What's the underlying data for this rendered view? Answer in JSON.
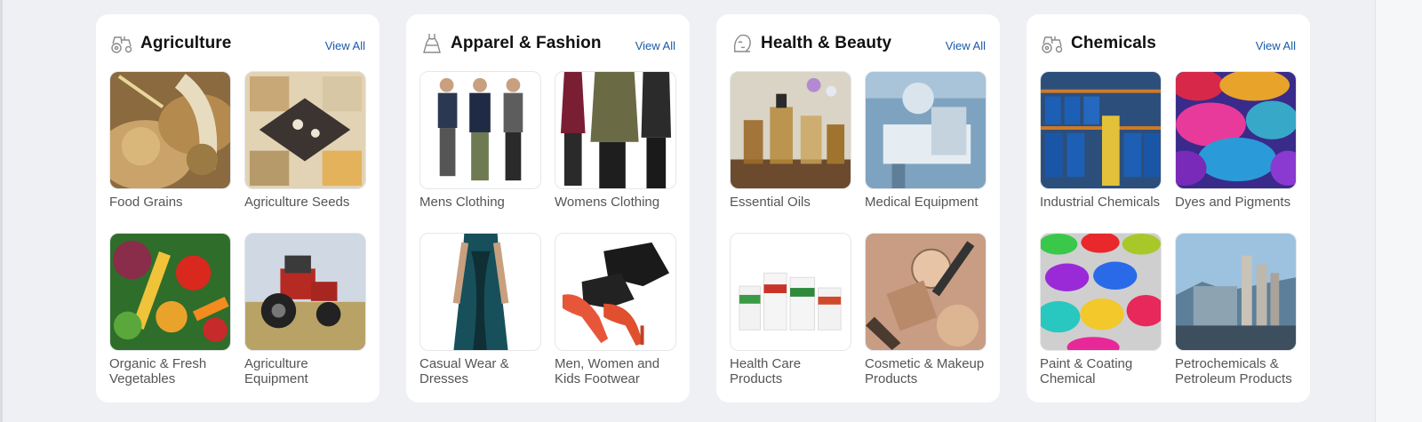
{
  "categories": [
    {
      "title": "Agriculture",
      "icon": "tractor-icon",
      "view_all": "View All",
      "items": [
        {
          "label": "Food Grains",
          "image": "food-grains-image"
        },
        {
          "label": "Agriculture Seeds",
          "image": "agriculture-seeds-image"
        },
        {
          "label": "Organic & Fresh Vegetables",
          "image": "vegetables-image"
        },
        {
          "label": "Agriculture Equipment",
          "image": "tractor-field-image"
        }
      ]
    },
    {
      "title": "Apparel & Fashion",
      "icon": "dress-icon",
      "view_all": "View All",
      "items": [
        {
          "label": "Mens Clothing",
          "image": "mens-clothing-image"
        },
        {
          "label": "Womens Clothing",
          "image": "womens-clothing-image"
        },
        {
          "label": "Casual Wear & Dresses",
          "image": "dress-image"
        },
        {
          "label": "Men, Women and Kids Footwear",
          "image": "footwear-image"
        }
      ]
    },
    {
      "title": "Health & Beauty",
      "icon": "beauty-face-icon",
      "view_all": "View All",
      "items": [
        {
          "label": "Essential Oils",
          "image": "essential-oils-image"
        },
        {
          "label": "Medical Equipment",
          "image": "medical-equipment-image"
        },
        {
          "label": "Health Care Products",
          "image": "health-care-products-image"
        },
        {
          "label": "Cosmetic & Makeup Products",
          "image": "cosmetics-image"
        }
      ]
    },
    {
      "title": "Chemicals",
      "icon": "tractor-icon",
      "view_all": "View All",
      "items": [
        {
          "label": "Industrial Chemicals",
          "image": "chemical-drums-image"
        },
        {
          "label": "Dyes and Pigments",
          "image": "pigments-image"
        },
        {
          "label": "Paint & Coating Chemical",
          "image": "paint-cans-image"
        },
        {
          "label": "Petrochemicals & Petroleum Products",
          "image": "refinery-image"
        }
      ]
    }
  ],
  "colors": {
    "link": "#1a5aa8",
    "background": "#eef0f3",
    "card": "#ffffff"
  }
}
